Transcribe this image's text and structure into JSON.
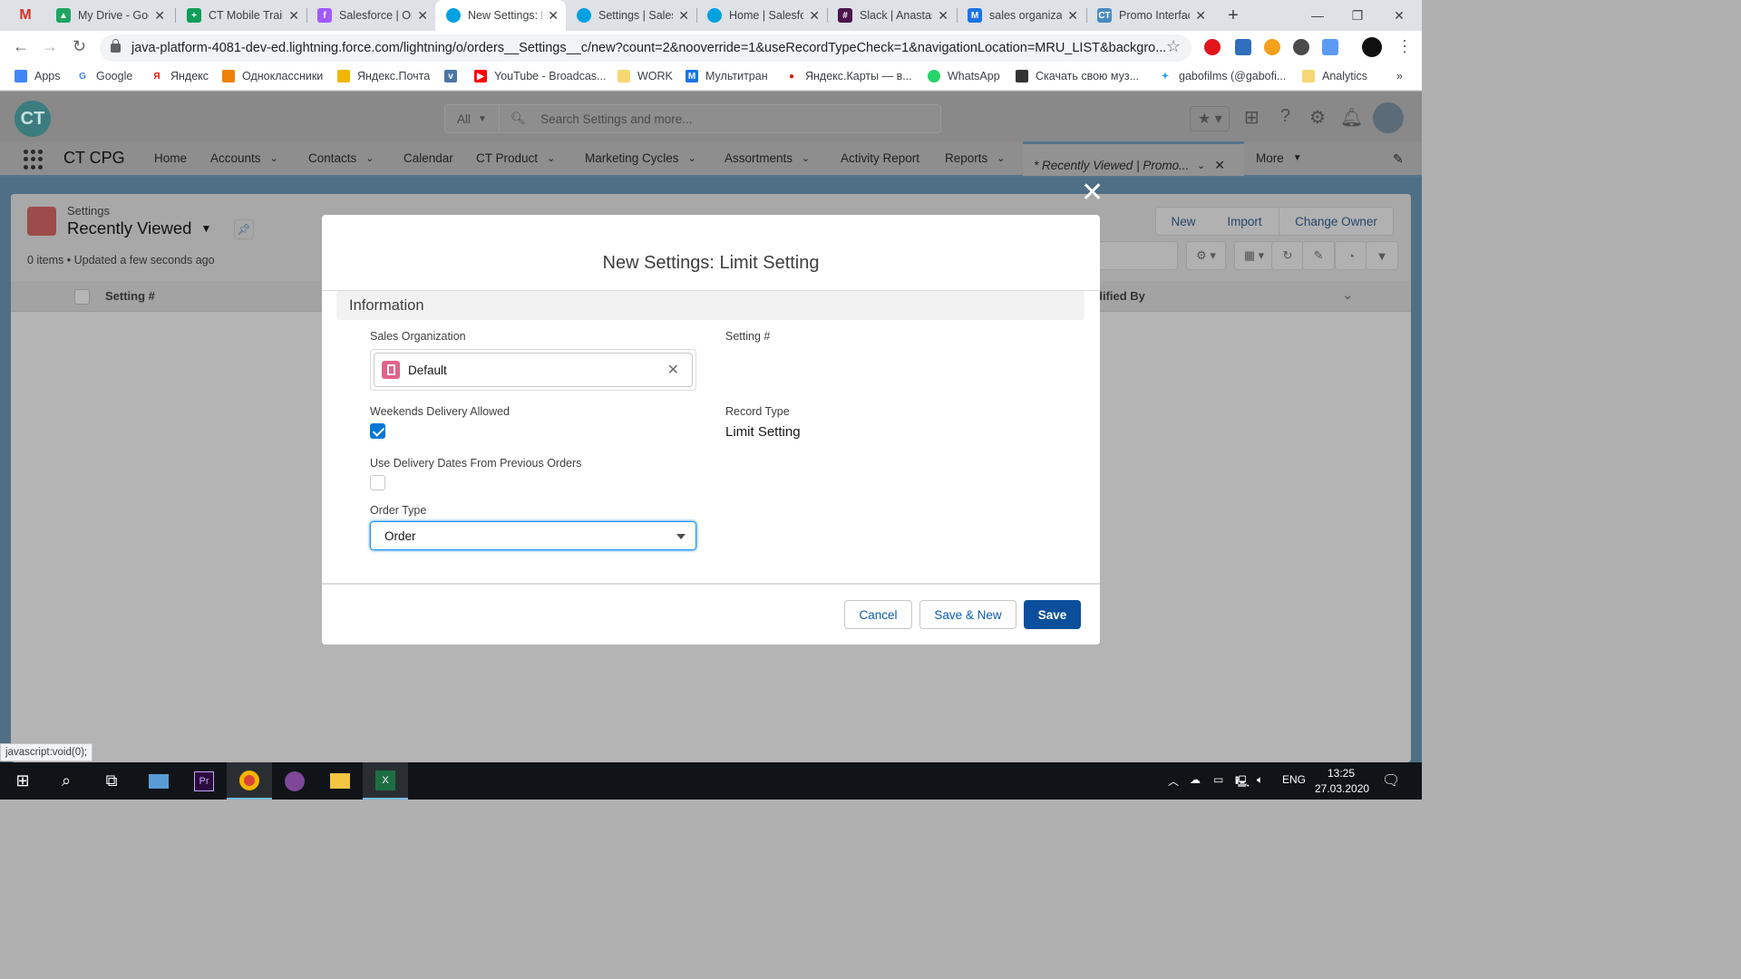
{
  "browser": {
    "tabs": [
      {
        "title": "",
        "icon": "gmail-icon",
        "color": "#d93025",
        "active": false
      },
      {
        "title": "My Drive - Google Drive",
        "icon": "drive-icon",
        "color": "#1fa463",
        "active": false
      },
      {
        "title": "CT Mobile Training",
        "icon": "sheets-icon",
        "color": "#0f9d58",
        "active": false
      },
      {
        "title": "Salesforce | Online",
        "icon": "figma-icon",
        "color": "#a259ff",
        "active": false
      },
      {
        "title": "New Settings: Limit",
        "icon": "salesforce-icon",
        "color": "#00a1e0",
        "active": true
      },
      {
        "title": "Settings | Salesforce",
        "icon": "salesforce-icon",
        "color": "#00a1e0",
        "active": false
      },
      {
        "title": "Home | Salesforce",
        "icon": "salesforce-icon",
        "color": "#00a1e0",
        "active": false
      },
      {
        "title": "Slack | Anastasia",
        "icon": "slack-icon",
        "color": "#4a154b",
        "active": false
      },
      {
        "title": "sales organization",
        "icon": "multitran-icon",
        "color": "#1a73e8",
        "active": false
      },
      {
        "title": "Promo Interface",
        "icon": "ct-icon",
        "color": "#4a8bbf",
        "active": false
      }
    ],
    "url": "java-platform-4081-dev-ed.lightning.force.com/lightning/o/orders__Settings__c/new?count=2&nooverride=1&useRecordTypeCheck=1&navigationLocation=MRU_LIST&backgro...",
    "bookmarks": [
      {
        "label": "Apps",
        "icon": "apps-grid-icon",
        "color": "#4285f4"
      },
      {
        "label": "Google",
        "icon": "google-icon",
        "color": "#4285f4"
      },
      {
        "label": "Яндекс",
        "icon": "yandex-icon",
        "color": "#e61400"
      },
      {
        "label": "Одноклассники",
        "icon": "ok-icon",
        "color": "#ee8208"
      },
      {
        "label": "Яндекс.Почта",
        "icon": "mail-icon",
        "color": "#f2b600"
      },
      {
        "label": "",
        "icon": "vk-icon",
        "color": "#4a76a8"
      },
      {
        "label": "YouTube - Broadcas...",
        "icon": "youtube-icon",
        "color": "#ff0000"
      },
      {
        "label": "WORK",
        "icon": "folder-icon",
        "color": "#f6d776"
      },
      {
        "label": "Мультитран",
        "icon": "multitran-icon",
        "color": "#1a73e8"
      },
      {
        "label": "Яндекс.Карты — в...",
        "icon": "map-pin-icon",
        "color": "#e61400"
      },
      {
        "label": "WhatsApp",
        "icon": "whatsapp-icon",
        "color": "#25d366"
      },
      {
        "label": "Скачать свою муз...",
        "icon": "cat-icon",
        "color": "#333333"
      },
      {
        "label": "gabofilms (@gabofi...",
        "icon": "twitter-icon",
        "color": "#1da1f2"
      },
      {
        "label": "Analytics",
        "icon": "folder-icon",
        "color": "#f6d776"
      }
    ],
    "bookmarks_more": "»"
  },
  "sf": {
    "logo": "CT",
    "search_scope": "All",
    "search_placeholder": "Search Settings and more...",
    "app_name": "CT CPG",
    "nav": [
      {
        "label": "Home",
        "chev": false
      },
      {
        "label": "Accounts",
        "chev": true
      },
      {
        "label": "Contacts",
        "chev": true
      },
      {
        "label": "Calendar",
        "chev": false
      },
      {
        "label": "CT Product",
        "chev": true
      },
      {
        "label": "Marketing Cycles",
        "chev": true
      },
      {
        "label": "Assortments",
        "chev": true
      },
      {
        "label": "Activity Report",
        "chev": false
      },
      {
        "label": "Reports",
        "chev": true
      }
    ],
    "active_tab": "* Recently Viewed | Promo...",
    "more": "More"
  },
  "list": {
    "object": "Settings",
    "view": "Recently Viewed",
    "meta": "0 items • Updated a few seconds ago",
    "col1": "Setting #",
    "col_last": "dified By",
    "buttons": [
      "New",
      "Import",
      "Change Owner"
    ]
  },
  "modal": {
    "title": "New Settings: Limit Setting",
    "section": "Information",
    "sales_org_label": "Sales Organization",
    "sales_org_value": "Default",
    "setting_num_label": "Setting #",
    "weekends_label": "Weekends Delivery Allowed",
    "weekends_checked": true,
    "record_type_label": "Record Type",
    "record_type_value": "Limit Setting",
    "prev_dates_label": "Use Delivery Dates From Previous Orders",
    "prev_dates_checked": false,
    "order_type_label": "Order Type",
    "order_type_value": "Order",
    "cancel": "Cancel",
    "save_new": "Save & New",
    "save": "Save"
  },
  "status_text": "javascript:void(0);",
  "taskbar": {
    "lang": "ENG",
    "time": "13:25",
    "date": "27.03.2020"
  }
}
